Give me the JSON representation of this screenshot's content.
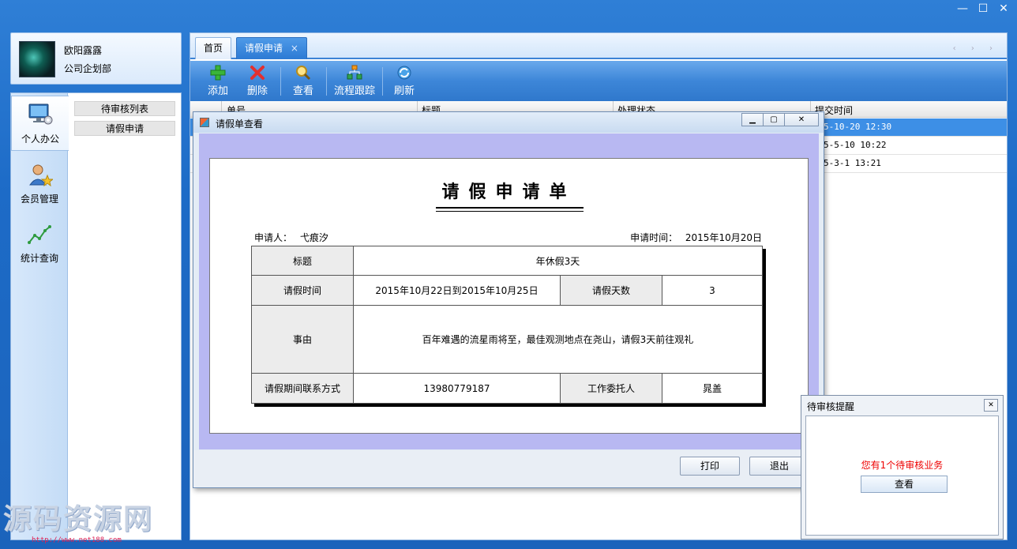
{
  "window": {
    "controls": [
      "—",
      "☐",
      "✕"
    ]
  },
  "user": {
    "name": "欧阳露露",
    "department": "公司企划部"
  },
  "nav": {
    "items": [
      {
        "label": "个人办公",
        "icon": "monitor-gear-icon"
      },
      {
        "label": "会员管理",
        "icon": "user-star-icon"
      },
      {
        "label": "统计查询",
        "icon": "line-chart-icon"
      }
    ],
    "sub_items": [
      "待审核列表",
      "请假申请"
    ]
  },
  "tabs": [
    {
      "label": "首页"
    },
    {
      "label": "请假申请",
      "close": "×"
    }
  ],
  "tab_nav": "‹ › ›",
  "toolbar": {
    "add": "添加",
    "delete": "删除",
    "view": "查看",
    "track": "流程跟踪",
    "refresh": "刷新"
  },
  "grid": {
    "columns": [
      "单号",
      "标题",
      "处理状态",
      "提交时间"
    ],
    "rows": [
      {
        "time": "5-10-20 12:30"
      },
      {
        "time": "5-5-10 10:22"
      },
      {
        "time": "5-3-1 13:21"
      }
    ]
  },
  "dialog": {
    "title": "请假单查看",
    "doc_title": "请假申请单",
    "applicant_label": "申请人：",
    "applicant": "弋痕汐",
    "apply_time_label": "申请时间：",
    "apply_time": "2015年10月20日",
    "table": {
      "title_label": "标题",
      "title": "年休假3天",
      "period_label": "请假时间",
      "period": "2015年10月22日到2015年10月25日",
      "days_label": "请假天数",
      "days": "3",
      "reason_label": "事由",
      "reason": "百年难遇的流星雨将至，最佳观测地点在尧山，请假3天前往观礼",
      "contact_label": "请假期间联系方式",
      "contact": "13980779187",
      "delegate_label": "工作委托人",
      "delegate": "晁盖"
    },
    "print": "打印",
    "exit": "退出"
  },
  "notice": {
    "title": "待审核提醒",
    "message": "您有1个待审核业务",
    "button": "查看"
  },
  "watermark": {
    "text": "源码资源网",
    "url": "http://www.net188.com"
  }
}
